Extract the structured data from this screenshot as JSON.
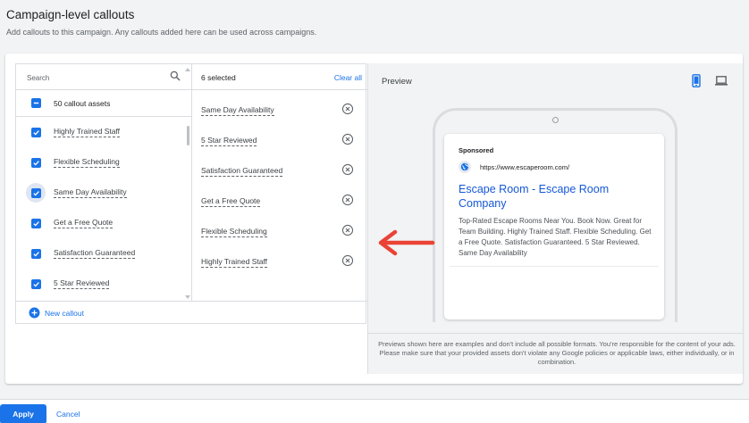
{
  "header": {
    "title": "Campaign-level callouts",
    "subtitle": "Add callouts to this campaign. Any callouts added here can be used across campaigns."
  },
  "picker": {
    "search_placeholder": "Search",
    "all_label": "50 callout assets",
    "items": [
      {
        "label": "Highly Trained Staff",
        "checked": true
      },
      {
        "label": "Flexible Scheduling",
        "checked": true
      },
      {
        "label": "Same Day Availability",
        "checked": true
      },
      {
        "label": "Get a Free Quote",
        "checked": true
      },
      {
        "label": "Satisfaction Guaranteed",
        "checked": true
      },
      {
        "label": "5 Star Reviewed",
        "checked": true
      }
    ],
    "selected_count": "6 selected",
    "clear_all": "Clear all",
    "selected": [
      "Same Day Availability",
      "5 Star Reviewed",
      "Satisfaction Guaranteed",
      "Get a Free Quote",
      "Flexible Scheduling",
      "Highly Trained Staff"
    ],
    "new_callout": "New callout"
  },
  "preview": {
    "title": "Preview",
    "ad": {
      "sponsored": "Sponsored",
      "url": "https://www.escaperoom.com/",
      "headline": "Escape Room - Escape Room Company",
      "description": "Top-Rated Escape Rooms Near You. Book Now. Great for Team Building. Highly Trained Staff. Flexible Scheduling. Get a Free Quote. Satisfaction Guaranteed. 5 Star Reviewed. Same Day Availability"
    },
    "disclaimer": "Previews shown here are examples and don't include all possible formats. You're responsible for the content of your ads. Please make sure that your provided assets don't violate any Google policies or applicable laws, either individually, or in combination."
  },
  "footer": {
    "apply": "Apply",
    "cancel": "Cancel"
  },
  "colors": {
    "accent": "#1a73e8",
    "annotation_arrow": "#ea4335"
  }
}
